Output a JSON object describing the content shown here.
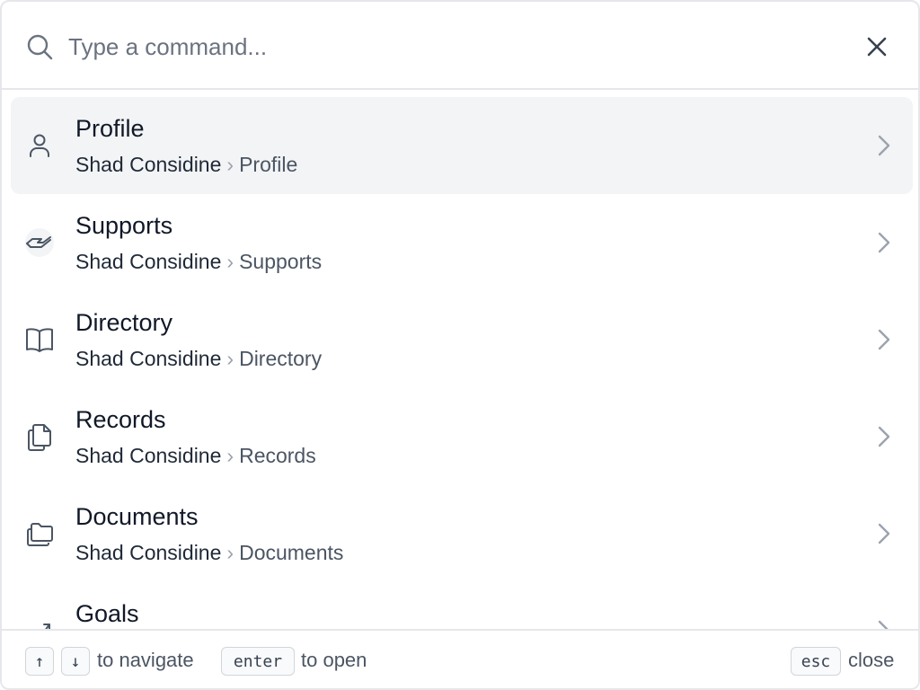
{
  "search": {
    "placeholder": "Type a command..."
  },
  "items": [
    {
      "title": "Profile",
      "root": "Shad Considine",
      "leaf": "Profile",
      "icon": "user-icon"
    },
    {
      "title": "Supports",
      "root": "Shad Considine",
      "leaf": "Supports",
      "icon": "handshake-icon"
    },
    {
      "title": "Directory",
      "root": "Shad Considine",
      "leaf": "Directory",
      "icon": "book-open-icon"
    },
    {
      "title": "Records",
      "root": "Shad Considine",
      "leaf": "Records",
      "icon": "files-icon"
    },
    {
      "title": "Documents",
      "root": "Shad Considine",
      "leaf": "Documents",
      "icon": "folders-icon"
    },
    {
      "title": "Goals",
      "root": "",
      "leaf": "",
      "icon": "goal-flag-icon"
    }
  ],
  "breadcrumb_separator": "›",
  "footer": {
    "up_key": "↑",
    "down_key": "↓",
    "navigate_hint": "to navigate",
    "enter_key": "enter",
    "open_hint": "to open",
    "esc_key": "esc",
    "close_hint": "close"
  },
  "colors": {
    "active_row": "#f3f4f6",
    "border": "#e5e7eb",
    "muted_text": "#4b5563"
  }
}
